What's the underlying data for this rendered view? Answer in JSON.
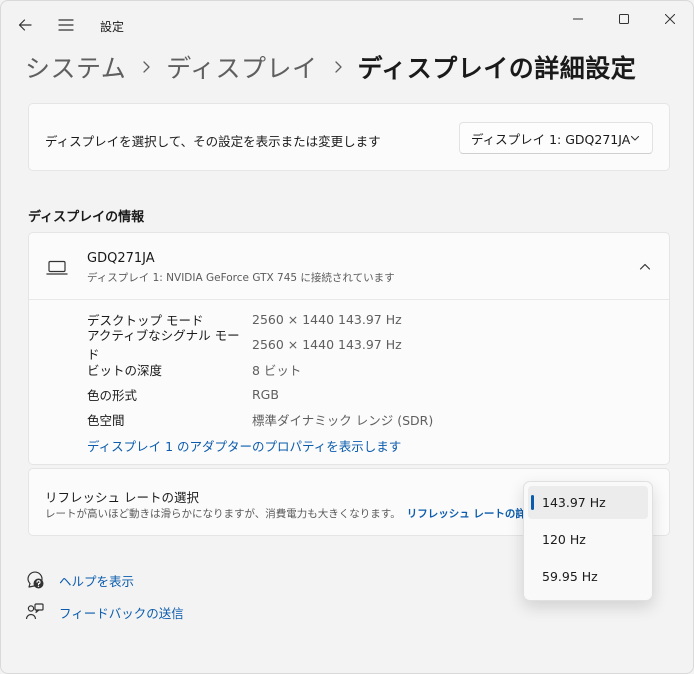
{
  "window": {
    "title": "設定"
  },
  "breadcrumb": {
    "items": [
      "システム",
      "ディスプレイ"
    ],
    "current": "ディスプレイの詳細設定"
  },
  "display_select": {
    "label": "ディスプレイを選択して、その設定を表示または変更します",
    "selected": "ディスプレイ 1: GDQ271JA"
  },
  "display_info": {
    "section_title": "ディスプレイの情報",
    "monitor_name": "GDQ271JA",
    "monitor_connection": "ディスプレイ 1: NVIDIA GeForce GTX 745 に接続されています",
    "properties": [
      {
        "label": "デスクトップ モード",
        "value": "2560 × 1440 143.97 Hz"
      },
      {
        "label": "アクティブなシグナル モード",
        "value": "2560 × 1440 143.97 Hz"
      },
      {
        "label": "ビットの深度",
        "value": "8 ビット"
      },
      {
        "label": "色の形式",
        "value": "RGB"
      },
      {
        "label": "色空間",
        "value": "標準ダイナミック レンジ (SDR)"
      }
    ],
    "adapter_link": "ディスプレイ 1 のアダプターのプロパティを表示します"
  },
  "refresh_rate": {
    "title": "リフレッシュ レートの選択",
    "description": "レートが高いほど動きは滑らかになりますが、消費電力も大きくなります。",
    "more_link": "リフレッシュ レートの詳細",
    "options": [
      "143.97 Hz",
      "120 Hz",
      "59.95 Hz"
    ],
    "selected": "143.97 Hz"
  },
  "footer": {
    "help": "ヘルプを表示",
    "feedback": "フィードバックの送信"
  },
  "colors": {
    "accent": "#0b5cad",
    "background": "#f3f3f3",
    "card": "#fbfbfb"
  },
  "icons": {
    "back": "back-arrow-icon",
    "menu": "hamburger-menu-icon",
    "display": "laptop-icon",
    "help": "help-icon",
    "feedback": "feedback-icon"
  }
}
